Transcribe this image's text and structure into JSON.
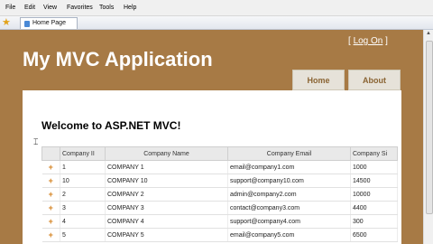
{
  "menu": [
    "File",
    "Edit",
    "View",
    "Favorites",
    "Tools",
    "Help"
  ],
  "tab": {
    "title": "Home Page"
  },
  "icons": {
    "favorites": "star-icon",
    "home": "home-icon",
    "feeds": "feed-icon",
    "print": "print-icon",
    "page": "page-icon",
    "tools": "tools-icon"
  },
  "site": {
    "logon_prefix": "[",
    "logon_label": "Log On",
    "logon_suffix": "]",
    "title": "My MVC Application",
    "nav": {
      "home": "Home",
      "about": "About"
    },
    "welcome": "Welcome to ASP.NET MVC!"
  },
  "grid": {
    "columns": [
      "Company II",
      "Company Name",
      "Company Email",
      "Company Si"
    ],
    "expander": "+",
    "rows": [
      [
        "1",
        "COMPANY 1",
        "email@company1.com",
        "1000"
      ],
      [
        "10",
        "COMPANY 10",
        "support@company10.com",
        "14500"
      ],
      [
        "2",
        "COMPANY 2",
        "admin@company2.com",
        "10000"
      ],
      [
        "3",
        "COMPANY 3",
        "contact@company3.com",
        "4400"
      ],
      [
        "4",
        "COMPANY 4",
        "support@company4.com",
        "300"
      ],
      [
        "5",
        "COMPANY 5",
        "email@company5.com",
        "6500"
      ]
    ]
  },
  "colors": {
    "header_brown": "#a77a45",
    "nav_button": "#e6e2d9",
    "nav_text": "#8a6433",
    "expander": "#d4821f"
  }
}
